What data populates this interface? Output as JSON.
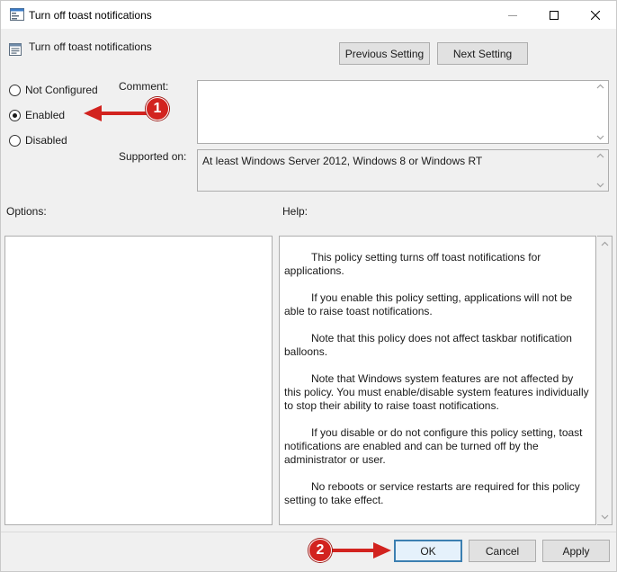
{
  "window": {
    "title": "Turn off toast notifications",
    "controls": {
      "minimize": "minimize",
      "maximize": "maximize",
      "close": "close"
    }
  },
  "header": {
    "setting_title": "Turn off toast notifications",
    "prev_label": "Previous Setting",
    "next_label": "Next Setting"
  },
  "state": {
    "options": [
      {
        "label": "Not Configured",
        "checked": false
      },
      {
        "label": "Enabled",
        "checked": true
      },
      {
        "label": "Disabled",
        "checked": false
      }
    ]
  },
  "comment": {
    "label": "Comment:",
    "value": ""
  },
  "supported": {
    "label": "Supported on:",
    "value": "At least Windows Server 2012, Windows 8 or Windows RT"
  },
  "options_panel": {
    "label": "Options:"
  },
  "help_panel": {
    "label": "Help:",
    "paragraphs": [
      "This policy setting turns off toast notifications for applications.",
      "If you enable this policy setting, applications will not be able to raise toast notifications.",
      "Note that this policy does not affect taskbar notification balloons.",
      "Note that Windows system features are not affected by this policy.  You must enable/disable system features individually to stop their ability to raise toast notifications.",
      "If you disable or do not configure this policy setting, toast notifications are enabled and can be turned off by the administrator or user.",
      "No reboots or service restarts are required for this policy setting to take effect."
    ]
  },
  "footer": {
    "ok_label": "OK",
    "cancel_label": "Cancel",
    "apply_label": "Apply"
  },
  "annotations": {
    "callout_1": "1",
    "callout_2": "2",
    "callout_color": "#d2231f"
  }
}
